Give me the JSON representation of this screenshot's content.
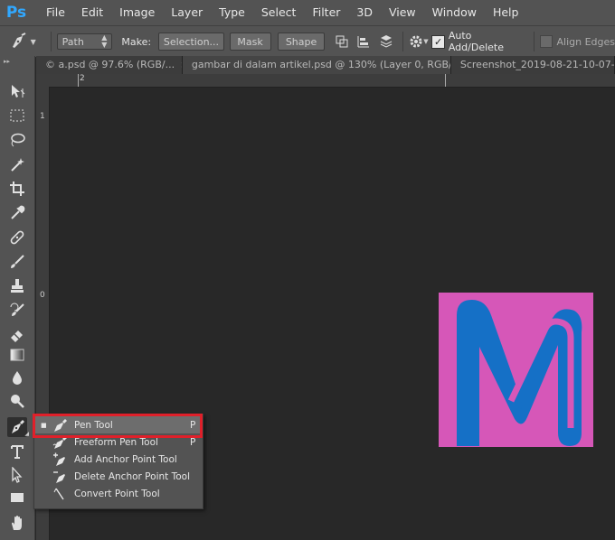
{
  "app": {
    "logo": "Ps"
  },
  "menu": [
    "File",
    "Edit",
    "Image",
    "Layer",
    "Type",
    "Select",
    "Filter",
    "3D",
    "View",
    "Window",
    "Help"
  ],
  "options_bar": {
    "mode_value": "Path",
    "make_label": "Make:",
    "selection_button": "Selection...",
    "mask_button": "Mask",
    "shape_button": "Shape",
    "auto_add_delete_label": "Auto Add/Delete",
    "auto_add_delete_checked": true,
    "align_edges_label": "Align Edges",
    "align_edges_checked": false
  },
  "tabs": [
    {
      "label": "© a.psd @ 97.6% (RGB/..."
    },
    {
      "label": "gambar di dalam artikel.psd @ 130% (Layer 0, RGB/..."
    },
    {
      "label": "Screenshot_2019-08-21-10-07-..."
    }
  ],
  "rulers": {
    "top_mark": "2",
    "left_marks": [
      "1",
      "0"
    ]
  },
  "tool_flyout": {
    "items": [
      {
        "label": "Pen Tool",
        "shortcut": "P",
        "icon": "pen-icon",
        "selected": true
      },
      {
        "label": "Freeform Pen Tool",
        "shortcut": "P",
        "icon": "freeform-pen-icon",
        "selected": false
      },
      {
        "label": "Add Anchor Point Tool",
        "shortcut": "",
        "icon": "add-anchor-icon",
        "selected": false
      },
      {
        "label": "Delete Anchor Point Tool",
        "shortcut": "",
        "icon": "delete-anchor-icon",
        "selected": false
      },
      {
        "label": "Convert Point Tool",
        "shortcut": "",
        "icon": "convert-point-icon",
        "selected": false
      }
    ],
    "selected_marker": "■"
  },
  "colors": {
    "logo_background": "#d657b8",
    "logo_mark": "#1570c6",
    "highlight_border": "#e0202a",
    "ps_blue": "#31a8ff"
  }
}
